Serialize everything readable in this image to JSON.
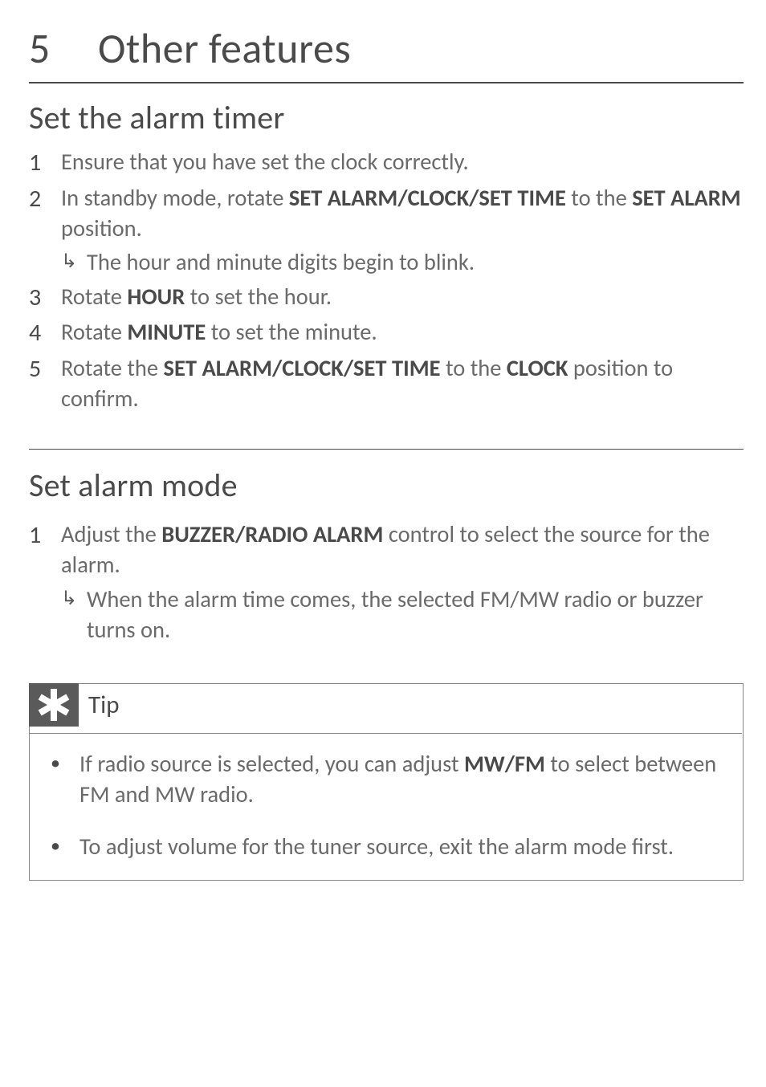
{
  "chapter": {
    "number": "5",
    "title": "Other features"
  },
  "section1": {
    "title": "Set the alarm timer",
    "steps": [
      {
        "num": "1",
        "pre": "Ensure that you have set the clock correctly."
      },
      {
        "num": "2",
        "pre": "In standby mode, rotate ",
        "b1": "SET ALARM/CLOCK/SET TIME",
        "mid": " to the ",
        "b2": "SET ALARM",
        "post": " position.",
        "result": "The hour and minute digits begin to blink."
      },
      {
        "num": "3",
        "pre": "Rotate ",
        "b1": "HOUR",
        "post": " to set the hour."
      },
      {
        "num": "4",
        "pre": "Rotate ",
        "b1": "MINUTE",
        "post": " to set the minute."
      },
      {
        "num": "5",
        "pre": "Rotate the ",
        "b1": "SET ALARM/CLOCK/SET TIME",
        "mid": " to the ",
        "b2": "CLOCK",
        "post": " position to confirm."
      }
    ]
  },
  "section2": {
    "title": "Set alarm mode",
    "steps": [
      {
        "num": "1",
        "pre": "Adjust the ",
        "b1": "BUZZER/RADIO ALARM",
        "post": " control to select the source for the alarm.",
        "result": "When the alarm time comes, the selected FM/MW radio or buzzer turns on."
      }
    ]
  },
  "tip": {
    "label": "Tip",
    "items": [
      {
        "pre": "If radio source is selected, you can adjust ",
        "b1": "MW/FM",
        "post": " to select between FM and MW radio."
      },
      {
        "pre": "To adjust volume for the tuner source, exit the alarm mode first."
      }
    ]
  }
}
